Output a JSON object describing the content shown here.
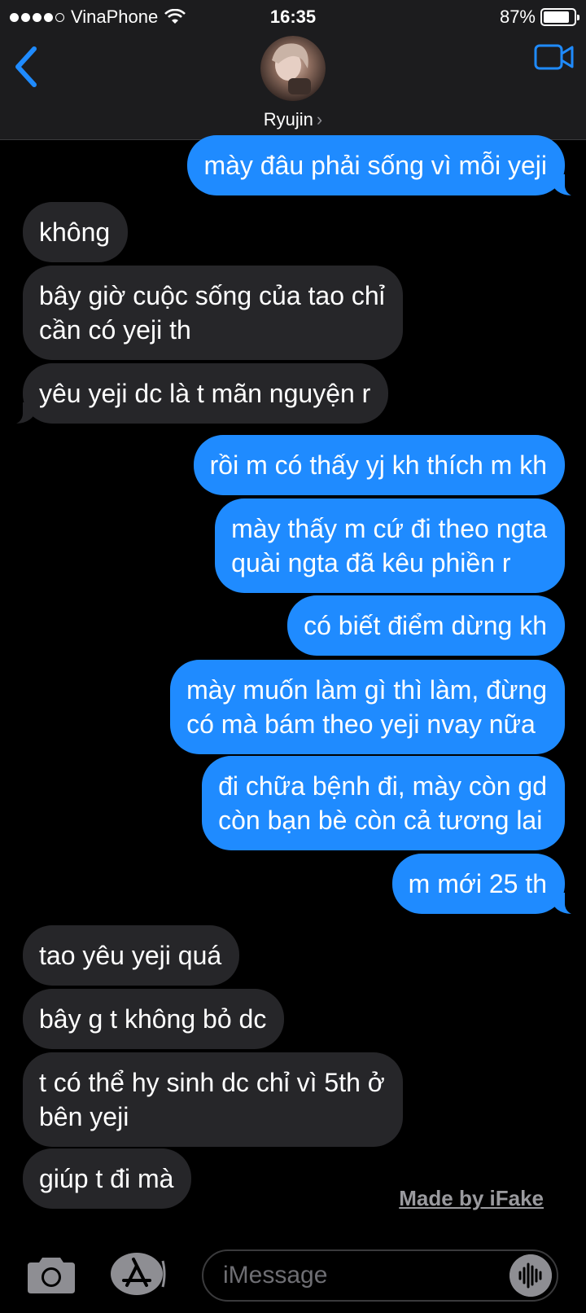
{
  "status_bar": {
    "carrier": "VinaPhone",
    "time": "16:35",
    "battery": "87%",
    "battery_level": 0.87
  },
  "header": {
    "contact_name": "Ryujin",
    "chevron": "›",
    "back_icon": "chevron-left-icon",
    "video_icon": "video-camera-icon"
  },
  "messages": [
    {
      "dir": "out",
      "text": "mày đâu phải sống vì mỗi yeji"
    },
    {
      "dir": "in",
      "text": "không"
    },
    {
      "dir": "in",
      "lines": [
        "bây giờ cuộc sống của tao chỉ",
        "cần có yeji th"
      ]
    },
    {
      "dir": "in",
      "text": "yêu yeji dc là t mãn nguyện r"
    },
    {
      "dir": "out",
      "text": "rồi m có thấy yj kh thích m kh"
    },
    {
      "dir": "out",
      "lines": [
        "mày thấy m cứ đi theo ngta",
        "quài ngta đã kêu phiền r"
      ]
    },
    {
      "dir": "out",
      "text": "có biết điểm dừng kh"
    },
    {
      "dir": "out",
      "lines": [
        "mày muốn làm gì thì làm, đừng",
        "có mà bám theo yeji nvay nữa"
      ]
    },
    {
      "dir": "out",
      "lines": [
        "đi chữa bệnh đi, mày còn gd",
        "còn bạn bè còn cả tương lai"
      ]
    },
    {
      "dir": "out",
      "text": "m mới 25 th"
    },
    {
      "dir": "in",
      "text": "tao yêu yeji quá"
    },
    {
      "dir": "in",
      "text": "bây g t không bỏ dc"
    },
    {
      "dir": "in",
      "lines": [
        "t có thể hy sinh dc chỉ vì 5th ở",
        "bên yeji"
      ]
    },
    {
      "dir": "in",
      "text": "giúp t đi mà"
    }
  ],
  "watermark": "Made by iFake",
  "input": {
    "placeholder": "iMessage",
    "camera_icon": "camera-icon",
    "apps_icon": "app-store-icon",
    "audio_icon": "audio-waveform-icon"
  },
  "colors": {
    "outgoing": "#1f8bff",
    "incoming": "#262629",
    "accent": "#1f8bff"
  }
}
